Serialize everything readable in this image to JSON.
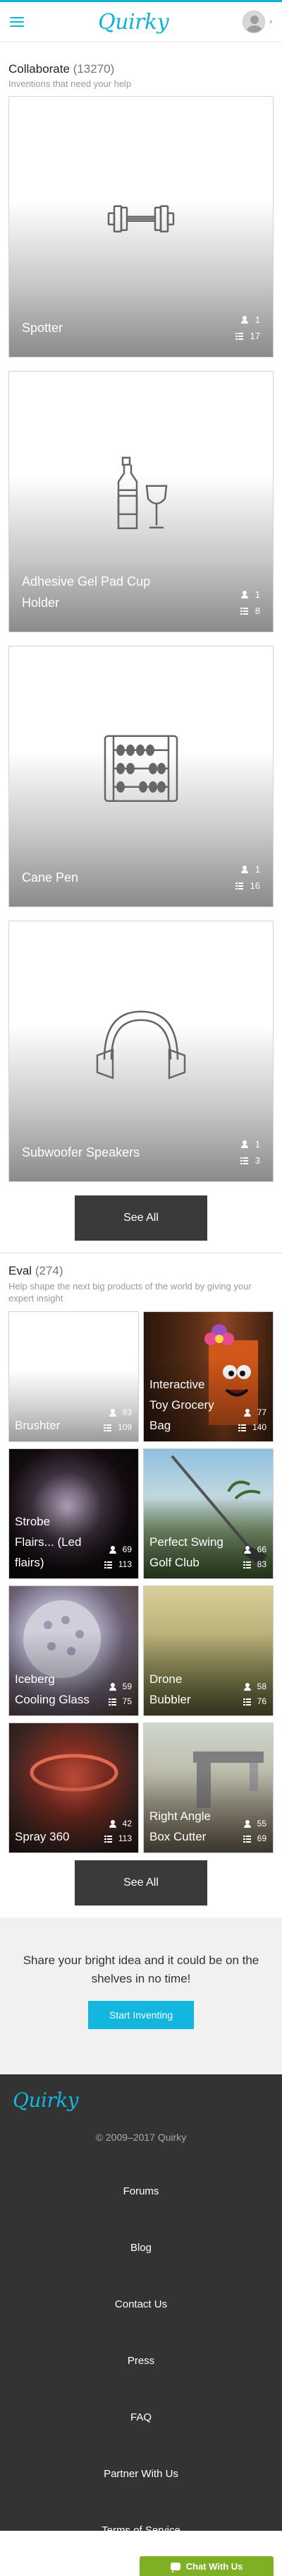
{
  "header": {
    "logo": "Quirky",
    "menu_icon": "hamburger-menu-icon",
    "profile_icon": "avatar-icon",
    "profile_chevron": "›"
  },
  "collaborate": {
    "title": "Collaborate",
    "count": "(13270)",
    "subtitle": "Inventions that need your help",
    "cards": [
      {
        "title": "Spotter",
        "icon": "dumbbell-icon",
        "people": "1",
        "ideas": "17"
      },
      {
        "title": "Adhesive Gel Pad Cup Holder",
        "icon": "bottle-and-glass-icon",
        "people": "1",
        "ideas": "8"
      },
      {
        "title": "Cane Pen",
        "icon": "abacus-icon",
        "people": "1",
        "ideas": "16"
      },
      {
        "title": "Subwoofer Speakers",
        "icon": "headphones-icon",
        "people": "1",
        "ideas": "3"
      }
    ],
    "see_all": "See All"
  },
  "eval": {
    "title": "Eval",
    "count": "(274)",
    "subtitle": "Help shape the next big products of the world by giving your expert insight",
    "cards": [
      {
        "title": "Brushter",
        "people": "93",
        "ideas": "109"
      },
      {
        "title": "Interactive Toy Grocery Bag",
        "people": "77",
        "ideas": "140"
      },
      {
        "title": "Strobe Flairs... (Led flairs)",
        "people": "69",
        "ideas": "113"
      },
      {
        "title": "Perfect Swing Golf Club",
        "people": "66",
        "ideas": "83"
      },
      {
        "title": "Iceberg Cooling Glass",
        "people": "59",
        "ideas": "75"
      },
      {
        "title": "Drone Bubbler",
        "people": "58",
        "ideas": "76"
      },
      {
        "title": "Spray 360",
        "people": "42",
        "ideas": "113"
      },
      {
        "title": "Right Angle Box Cutter",
        "people": "55",
        "ideas": "69"
      }
    ],
    "see_all": "See All"
  },
  "share": {
    "text": "Share your bright idea and it could be on the shelves in no time!",
    "cta": "Start Inventing"
  },
  "footer": {
    "logo": "Quirky",
    "copyright": "© 2009–2017 Quirky",
    "links": [
      "Forums",
      "Blog",
      "Contact Us",
      "Press",
      "FAQ",
      "Partner With Us",
      "Terms of Service"
    ]
  },
  "chat": {
    "label": "Chat With Us"
  },
  "colors": {
    "brand": "#0fb3d8",
    "dark_button": "#3a3a3a",
    "footer_bg": "#333333",
    "chat_green": "#7fb024"
  }
}
